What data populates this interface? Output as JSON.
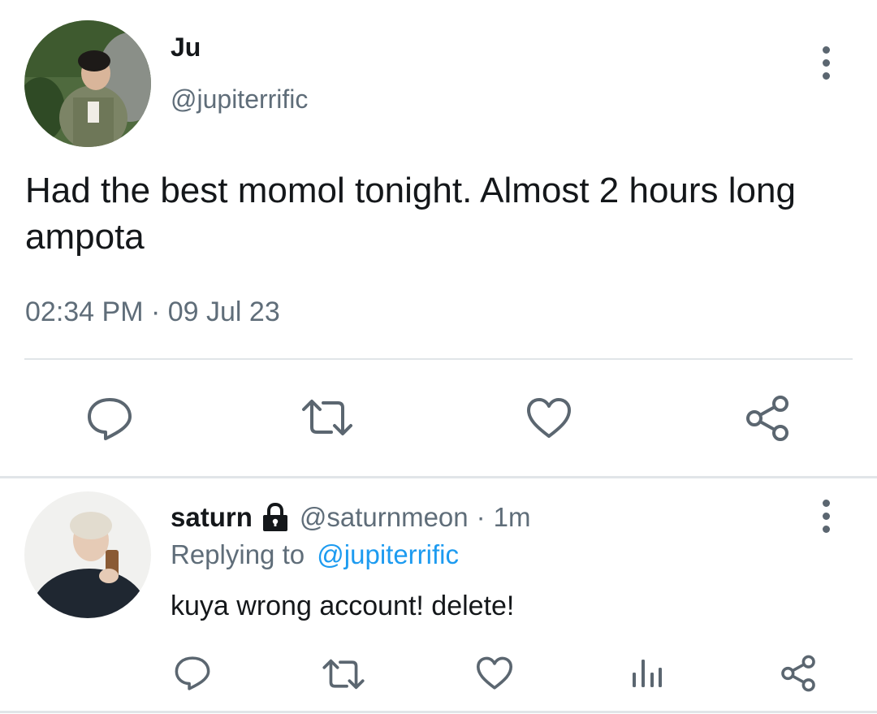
{
  "main_tweet": {
    "display_name": "Ju",
    "handle": "@jupiterrific",
    "text": "Had the best momol tonight. Almost 2 hours long ampota",
    "timestamp": "02:34 PM · 09 Jul 23",
    "actions": [
      "reply-icon",
      "retweet-icon",
      "like-icon",
      "share-icon"
    ]
  },
  "reply": {
    "display_name": "saturn",
    "locked_icon": "lock-icon",
    "handle": "@saturnmeon",
    "separator": "·",
    "time": "1m",
    "replying_prefix": "Replying to",
    "replying_to": "@jupiterrific",
    "text": "kuya wrong account! delete!",
    "actions": [
      "reply-icon",
      "retweet-icon",
      "like-icon",
      "analytics-icon",
      "share-icon"
    ]
  },
  "colors": {
    "text": "#14171a",
    "muted": "#5f6d79",
    "link": "#1d9bf0",
    "divider": "#e1e5e8"
  }
}
